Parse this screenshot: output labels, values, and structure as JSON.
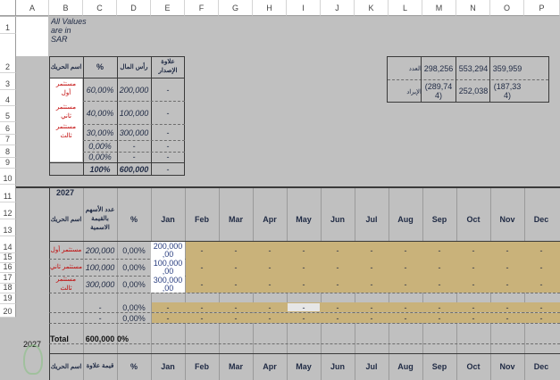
{
  "columns": [
    "A",
    "B",
    "C",
    "D",
    "E",
    "F",
    "G",
    "H",
    "I",
    "J",
    "K",
    "L",
    "M",
    "N",
    "O",
    "P"
  ],
  "rows": [
    "1",
    "2",
    "3",
    "4",
    "5",
    "6",
    "7",
    "8",
    "9",
    "10",
    "11",
    "12",
    "13",
    "14",
    "15",
    "16",
    "17",
    "18",
    "19",
    "20"
  ],
  "note": "All Values are in SAR",
  "top_table": {
    "headers": {
      "name": "اسم الحريك",
      "pct": "%",
      "capital": "رأس المال",
      "premium": "علاوة الإصدار"
    },
    "rows": [
      {
        "name": "مستثمر أول",
        "pct": "60,00%",
        "capital": "200,000",
        "premium": "-"
      },
      {
        "name": "مستثمر ثاني",
        "pct": "40,00%",
        "capital": "100,000",
        "premium": "-"
      },
      {
        "name": "مستثمر ثالث",
        "pct": "30,00%",
        "capital": "300,000",
        "premium": "-"
      },
      {
        "name": "",
        "pct": "0,00%",
        "capital": "-",
        "premium": "-"
      },
      {
        "name": "",
        "pct": "0,00%",
        "capital": "-",
        "premium": "-"
      }
    ],
    "total": {
      "pct": "100%",
      "capital": "600,000",
      "premium": "-"
    }
  },
  "summary_box": {
    "label_1": "العدد",
    "label_2": "الإيراد",
    "row1": [
      "298,256",
      "553,294",
      "359,959"
    ],
    "row2": [
      "(289,74\n4)",
      "252,038",
      "(187,33\n4)"
    ]
  },
  "year_label": "2027",
  "year_side": "2027",
  "lower": {
    "headers": {
      "name": "اسم الحريك",
      "shares": "عدد الأسهم بالقيمة الاسمية",
      "pct": "%"
    },
    "months": [
      "Jan",
      "Feb",
      "Mar",
      "Apr",
      "May",
      "Jun",
      "Jul",
      "Aug",
      "Sep",
      "Oct",
      "Nov",
      "Dec"
    ],
    "rows": [
      {
        "name": "مستثمر أول",
        "shares": "200,000",
        "pct": "0,00%",
        "jan": "200,000\n,00"
      },
      {
        "name": "مستثمر ثاني",
        "shares": "100,000",
        "pct": "0,00%",
        "jan": "100,000\n,00"
      },
      {
        "name": "مستثمر ثالث",
        "shares": "300,000",
        "pct": "0,00%",
        "jan": "300,000\n,00"
      },
      {
        "name": "",
        "shares": "-",
        "pct": "0,00%",
        "jan": ""
      },
      {
        "name": "",
        "shares": "-",
        "pct": "0,00%",
        "jan": ""
      }
    ],
    "dash": "-",
    "total_label": "Total",
    "total_value": "600,000",
    "total_pct": "0%",
    "footer": {
      "name": "اسم الحريك",
      "shares": "قيمة علاوة",
      "pct": "%"
    }
  }
}
